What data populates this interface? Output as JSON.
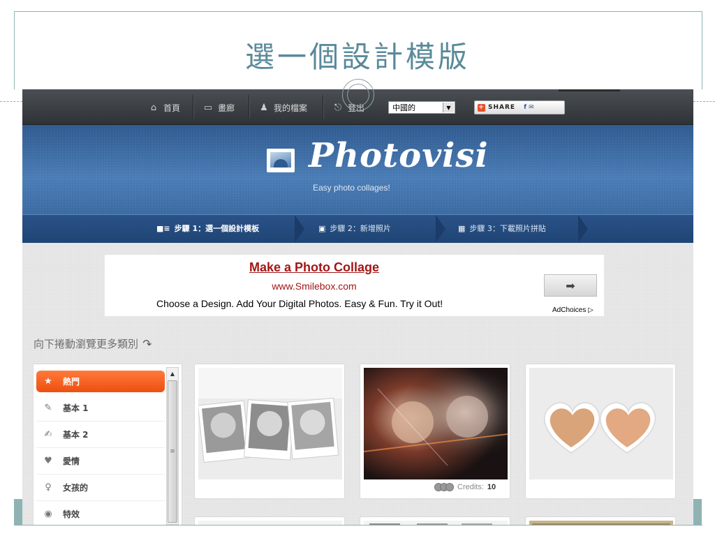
{
  "slide": {
    "title": "選一個設計模版"
  },
  "topnav": {
    "items": [
      {
        "icon": "home-icon",
        "label": "首頁"
      },
      {
        "icon": "gallery-icon",
        "label": "畫廊"
      },
      {
        "icon": "user-icon",
        "label": "我的檔案"
      },
      {
        "icon": "logout-icon",
        "label": "登出"
      }
    ],
    "language": "中國的",
    "share_label": "SHARE",
    "share_social": "f ✉"
  },
  "header": {
    "logo": "Photovisi",
    "tagline": "Easy photo collages!"
  },
  "steps": [
    {
      "icon": "list-icon",
      "label": "步驟 1：選一個設計模板"
    },
    {
      "icon": "add-photo-icon",
      "label": "步驟 2：新增照片"
    },
    {
      "icon": "film-icon",
      "label": "步驟 3：下載照片拼貼"
    }
  ],
  "ad": {
    "title": "Make a Photo Collage",
    "url": "www.Smilebox.com",
    "description": "Choose a Design. Add Your Digital Photos. Easy & Fun. Try it Out!",
    "arrow": "➡",
    "choices": "AdChoices ▷"
  },
  "scroll_hint": "向下捲動瀏覽更多類別",
  "categories": [
    {
      "icon": "star-icon",
      "glyph": "★",
      "label": "熱門"
    },
    {
      "icon": "pencil-icon",
      "glyph": "✎",
      "label": "基本 1"
    },
    {
      "icon": "edit-icon",
      "glyph": "✍",
      "label": "基本 2"
    },
    {
      "icon": "heart-icon",
      "glyph": "♥",
      "label": "愛情"
    },
    {
      "icon": "girl-icon",
      "glyph": "♀",
      "label": "女孩的"
    },
    {
      "icon": "eye-icon",
      "glyph": "◉",
      "label": "特效"
    }
  ],
  "templates": {
    "credits_label": "Credits:",
    "credits_value": "10"
  },
  "colors": {
    "accent_orange": "#ee4f10",
    "header_blue": "#4a7cb6",
    "ad_red": "#a21616"
  }
}
